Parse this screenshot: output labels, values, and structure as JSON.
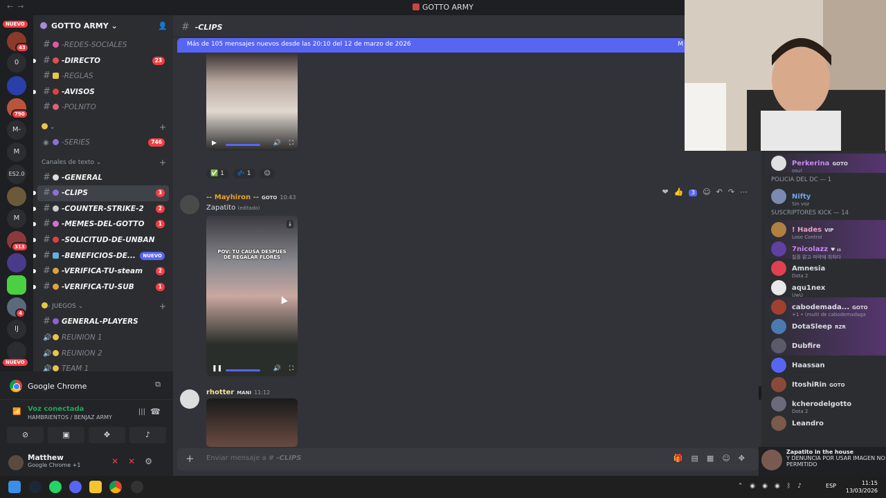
{
  "window": {
    "title": "GOTTO ARMY"
  },
  "rail": {
    "items": [
      {
        "label": "NUEVO"
      },
      {
        "label": "43"
      },
      {
        "label": "0"
      },
      {
        "label": ""
      },
      {
        "label": "790"
      },
      {
        "label": "M-"
      },
      {
        "label": "M"
      },
      {
        "label": "ES2.0"
      },
      {
        "label": ""
      },
      {
        "label": "M"
      },
      {
        "label": "313"
      },
      {
        "label": ""
      },
      {
        "label": ""
      },
      {
        "label": "4"
      },
      {
        "label": "IJ"
      },
      {
        "label": "NUEVO"
      }
    ]
  },
  "sidebar": {
    "server_name": "GOTTO ARMY",
    "channels_top": [
      {
        "name": "-REDES-SOCIALES",
        "bold": false,
        "badge": "",
        "emoji": "#e05aa0"
      },
      {
        "name": "-DIRECTO",
        "bold": true,
        "badge": "23",
        "emoji": "#e05050"
      },
      {
        "name": "-REGLAS",
        "bold": false,
        "badge": "",
        "emoji": "#e8c44a"
      },
      {
        "name": "-AVISOS",
        "bold": true,
        "badge": "",
        "emoji": "#e04040"
      },
      {
        "name": "-POLNITO",
        "bold": false,
        "badge": "",
        "emoji": "#e06070"
      }
    ],
    "category1": "",
    "series": {
      "name": "-SERIES",
      "badge": "746"
    },
    "category2": "Canales de texto",
    "channels_text": [
      {
        "name": "-GENERAL",
        "bold": true,
        "badge": "",
        "emoji": "#dddddd"
      },
      {
        "name": "-CLIPS",
        "bold": true,
        "badge": "3",
        "emoji": "#8b6fd8",
        "active": true
      },
      {
        "name": "-COUNTER-STRIKE-2",
        "bold": true,
        "badge": "2",
        "emoji": "#cccccc"
      },
      {
        "name": "-MEMES-DEL-GOTTO",
        "bold": true,
        "badge": "1",
        "emoji": "#d070d0"
      },
      {
        "name": "-SOLICITUD-DE-UNBAN",
        "bold": true,
        "badge": "",
        "emoji": "#e04040"
      },
      {
        "name": "-BENEFICIOS-DE...",
        "bold": true,
        "badge": "NUEVO",
        "emoji": "#60b0e0"
      },
      {
        "name": "-VERIFICA-TU-steam",
        "bold": true,
        "badge": "2",
        "emoji": "#e0a040"
      },
      {
        "name": "-VERIFICA-TU-SUB",
        "bold": true,
        "badge": "1",
        "emoji": "#e0a040"
      }
    ],
    "category3": "- JUEGOS",
    "channels_games": [
      {
        "name": "GENERAL-PLAYERS",
        "bold": true,
        "type": "text",
        "emoji": "#9060d0"
      },
      {
        "name": "REUNION 1",
        "bold": false,
        "type": "voice",
        "emoji": "#e8c44a"
      },
      {
        "name": "REUNION 2",
        "bold": false,
        "type": "voice",
        "emoji": "#e8c44a"
      },
      {
        "name": "TEAM 1",
        "bold": false,
        "type": "voice",
        "emoji": "#e8c44a"
      }
    ]
  },
  "voice_panel": {
    "activity": "Google Chrome",
    "status": "Voz conectada",
    "channel": "HAMBRIENTOS / BENJAZ ARMY",
    "user": {
      "name": "Matthew",
      "sub": "Google Chrome +1"
    }
  },
  "chat": {
    "channel": "-CLIPS",
    "new_messages_banner": "Más de 105 mensajes nuevos desde las 20:10 del 12 de marzo de 2026",
    "banner_right": "M",
    "reactions1": [
      {
        "emoji": "✅",
        "count": "1"
      },
      {
        "emoji": "💤",
        "count": "1"
      }
    ],
    "message1": {
      "author": "-- Mayhiron --",
      "tag": "GOTO",
      "time": "10:43",
      "text": "Zapatito",
      "edited": "(editado)",
      "caption": "POV: TU CAUSA DESPUES DE REGALAR FLORES",
      "reaction_count": "3"
    },
    "message2": {
      "author": "rhotter",
      "tag": "MANI",
      "time": "11:12"
    },
    "composer_placeholder": "Enviar mensaje a #",
    "composer_channel": "-CLIPS"
  },
  "members": {
    "top": {
      "name": "Perkerina",
      "tag": "GOTO",
      "status": "osu!"
    },
    "category_policia": "POLICIA DEL DC — 1",
    "policia": [
      {
        "name": "Nifty",
        "status": "Sin voz",
        "color": "#71a5e8"
      }
    ],
    "category_subs": "SUSCRIPTORES KICK — 14",
    "subs": [
      {
        "name": "! Hades",
        "tag": "VIP",
        "status": "Lose Control",
        "color": "#e8a0c8",
        "hl": true
      },
      {
        "name": "7nicolazz",
        "tag": "♥ ₁₅",
        "status": "칠흘 맑고 마약에 취하다",
        "color": "#c58af0",
        "hl": true
      },
      {
        "name": "Amnesia",
        "tag": "",
        "status": "Dota 2",
        "color": "#dbdee1",
        "hl": false
      },
      {
        "name": "aqu1nex",
        "tag": "",
        "status": "UwU",
        "color": "#dbdee1",
        "hl": false
      },
      {
        "name": "cabodemada...",
        "tag": "GOTO",
        "status": "+1 • (multi de cabodemadaga",
        "color": "#dbdee1",
        "hl": true
      },
      {
        "name": "DotaSleep",
        "tag": "RZR",
        "status": "",
        "color": "#dbdee1",
        "hl": true
      },
      {
        "name": "Dubfire",
        "tag": "",
        "status": "",
        "color": "#dbdee1",
        "hl": true
      },
      {
        "name": "Haassan",
        "tag": "",
        "status": "",
        "color": "#dbdee1",
        "hl": false
      },
      {
        "name": "ItoshiRin",
        "tag": "GOTO",
        "status": "",
        "color": "#dbdee1",
        "hl": false
      },
      {
        "name": "kcherodelgotto",
        "tag": "",
        "status": "Dota 2",
        "color": "#dbdee1",
        "hl": false
      },
      {
        "name": "Leandro",
        "tag": "",
        "status": "",
        "color": "#dbdee1",
        "hl": false
      }
    ]
  },
  "notification": {
    "title": "Zapatito in the house",
    "body": "Y DENUNCIA POR USAR IMAGEN NO PERMITIDO"
  },
  "taskbar": {
    "lang": "ESP",
    "time": "11:15",
    "date": "13/03/2026"
  }
}
